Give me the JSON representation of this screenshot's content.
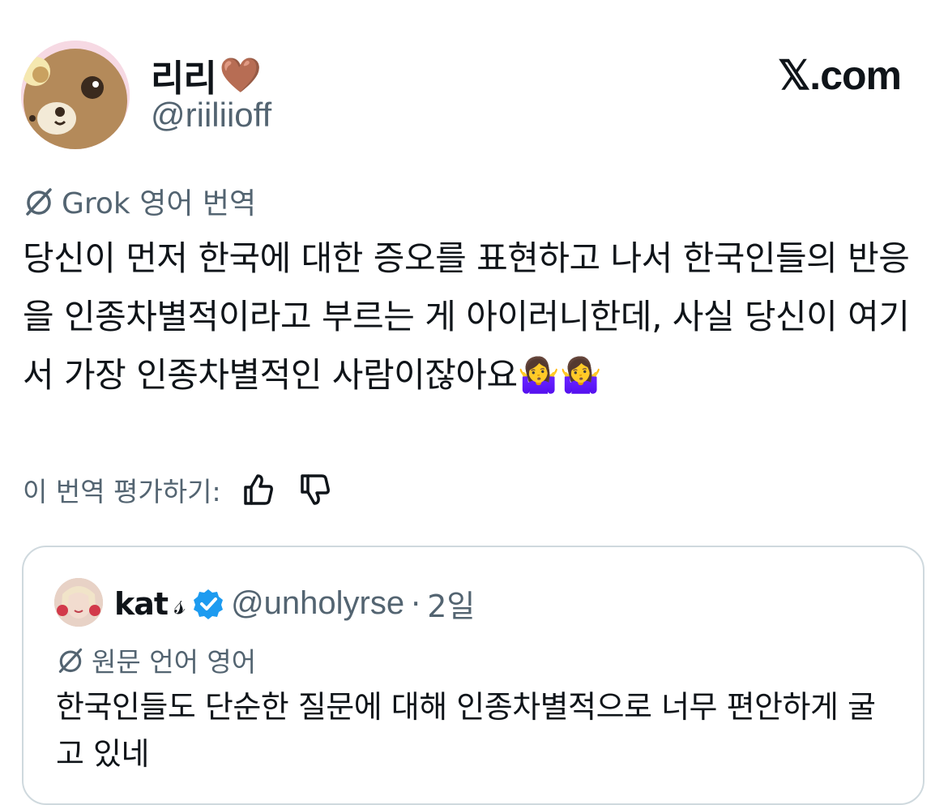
{
  "author": {
    "display_name": "리리",
    "name_emoji": "🤎",
    "handle": "@riiliioff",
    "avatar_icon": "bear-avatar"
  },
  "site_logo": "𝕏.com",
  "translation": {
    "label": "Grok 영어 번역",
    "icon": "grok-icon",
    "text": "당신이 먼저 한국에 대한 증오를 표현하고 나서 한국인들의 반응을 인종차별적이라고 부르는 게 아이러니한데, 사실 당신이 여기서 가장 인종차별적인 사람이잖아요🤷‍♀️🤷‍♀️",
    "rate_label": "이 번역 평가하기:",
    "thumbs_up_icon": "thumbs-up-icon",
    "thumbs_down_icon": "thumbs-down-icon"
  },
  "quoted": {
    "display_name": "kat",
    "name_deco": "𝓈",
    "verified_icon": "verified-badge-icon",
    "handle": "@unholyrse",
    "separator": "·",
    "time": "2일",
    "orig_lang_label": "원문 언어 영어",
    "text": "한국인들도 단순한 질문에 대해 인종차별적으로 너무 편안하게 굴고 있네"
  },
  "colors": {
    "text": "#0f1419",
    "secondary": "#536471",
    "verified": "#1d9bf0",
    "border": "#cfd9de"
  }
}
